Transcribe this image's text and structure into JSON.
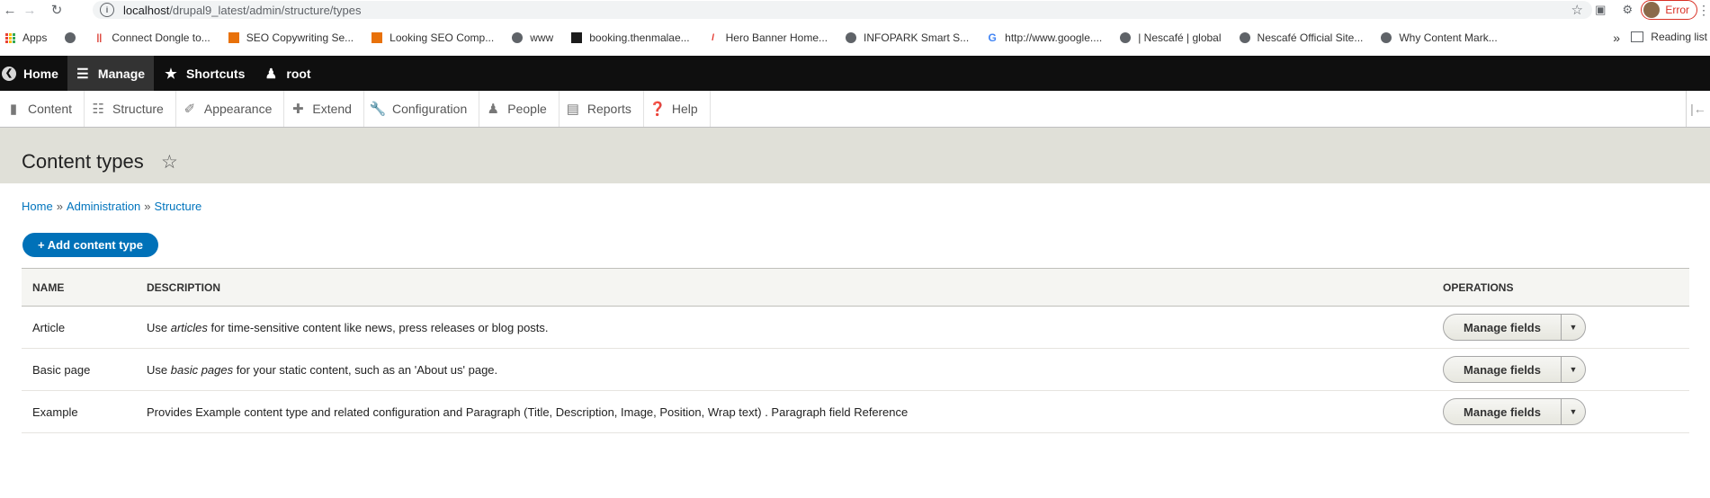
{
  "browser": {
    "url_host": "localhost",
    "url_path": "/drupal9_latest/admin/structure/types",
    "profile_status": "Error",
    "bookmarks": [
      {
        "label": "Apps",
        "icon": "apps-grid-icon"
      },
      {
        "label": "Connect Dongle to...",
        "icon": "red-bar-icon"
      },
      {
        "label": "SEO Copywriting Se...",
        "icon": "orange-box-icon"
      },
      {
        "label": "Looking SEO Comp...",
        "icon": "orange-box-icon"
      },
      {
        "label": "www",
        "icon": "globe-icon"
      },
      {
        "label": "booking.thenmalae...",
        "icon": "dark-square-icon"
      },
      {
        "label": "Hero Banner Home...",
        "icon": "red-flag-icon"
      },
      {
        "label": "INFOPARK Smart S...",
        "icon": "globe-icon"
      },
      {
        "label": "http://www.google....",
        "icon": "google-icon"
      },
      {
        "label": "| Nescafé | global",
        "icon": "globe-icon"
      },
      {
        "label": "Nescafé Official Site...",
        "icon": "globe-icon"
      },
      {
        "label": "Why Content Mark...",
        "icon": "globe-icon"
      }
    ],
    "more": "»",
    "reading_list": "Reading list"
  },
  "toolbar": {
    "home": "Home",
    "manage": "Manage",
    "shortcuts": "Shortcuts",
    "user": "root"
  },
  "tray": [
    {
      "label": "Content",
      "icon": "content-icon"
    },
    {
      "label": "Structure",
      "icon": "structure-icon"
    },
    {
      "label": "Appearance",
      "icon": "appearance-icon"
    },
    {
      "label": "Extend",
      "icon": "extend-icon"
    },
    {
      "label": "Configuration",
      "icon": "configuration-icon"
    },
    {
      "label": "People",
      "icon": "people-icon"
    },
    {
      "label": "Reports",
      "icon": "reports-icon"
    },
    {
      "label": "Help",
      "icon": "help-icon"
    }
  ],
  "page": {
    "title": "Content types",
    "breadcrumb": [
      "Home",
      "Administration",
      "Structure"
    ],
    "breadcrumb_sep": "»",
    "add_button": "+ Add content type"
  },
  "table": {
    "headers": {
      "name": "NAME",
      "description": "DESCRIPTION",
      "operations": "OPERATIONS"
    },
    "rows": [
      {
        "name": "Article",
        "desc_pre": "Use ",
        "desc_em": "articles",
        "desc_post": " for time-sensitive content like news, press releases or blog posts.",
        "op": "Manage fields"
      },
      {
        "name": "Basic page",
        "desc_pre": "Use ",
        "desc_em": "basic pages",
        "desc_post": " for your static content, such as an 'About us' page.",
        "op": "Manage fields"
      },
      {
        "name": "Example",
        "desc_pre": "Provides Example content type and related configuration and Paragraph (Title, Description, Image, Position, Wrap text) . Paragraph field Reference",
        "desc_em": "",
        "desc_post": "",
        "op": "Manage fields"
      }
    ]
  },
  "colors": {
    "toolbar_bg": "#0f0f0f",
    "head_band": "#e0e0d8",
    "link": "#0074bd",
    "primary_button": "#0071b8"
  }
}
